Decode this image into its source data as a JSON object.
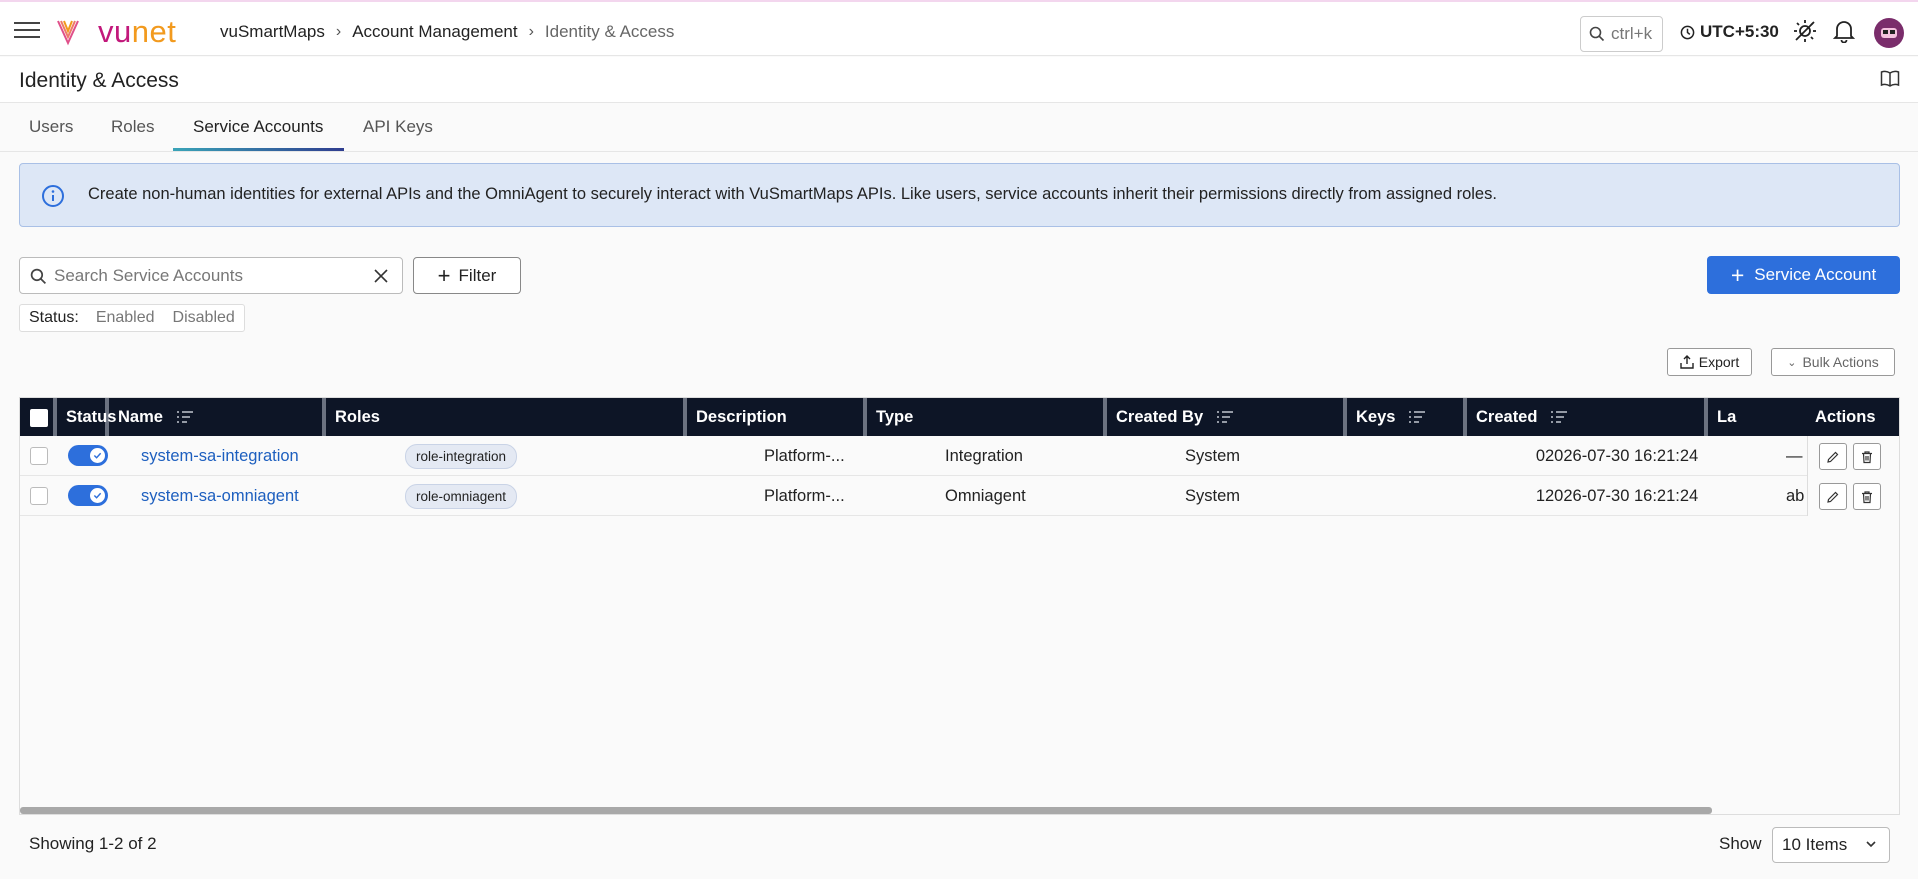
{
  "header": {
    "logo_text_a": "vu",
    "logo_text_b": "net",
    "breadcrumb": [
      "vuSmartMaps",
      "Account Management",
      "Identity & Access"
    ],
    "command_hint": "ctrl+k",
    "timezone": "UTC+5:30"
  },
  "page": {
    "title": "Identity & Access"
  },
  "tabs": [
    {
      "label": "Users",
      "active": false
    },
    {
      "label": "Roles",
      "active": false
    },
    {
      "label": "Service Accounts",
      "active": true
    },
    {
      "label": "API Keys",
      "active": false
    }
  ],
  "info_banner": {
    "text": "Create non-human identities for external APIs and the OmniAgent to securely interact with VuSmartMaps APIs. Like users, service accounts inherit their permissions directly from assigned roles."
  },
  "toolbar": {
    "search_placeholder": "Search Service Accounts",
    "filter_label": "Filter",
    "add_label": "Service Account",
    "status_label": "Status:",
    "status_options": [
      "Enabled",
      "Disabled"
    ],
    "export_label": "Export",
    "bulk_label": "Bulk Actions"
  },
  "table": {
    "columns": [
      "Status",
      "Name",
      "Roles",
      "Description",
      "Type",
      "Created By",
      "Keys",
      "Created",
      "La",
      "Actions"
    ],
    "rows": [
      {
        "enabled": true,
        "name": "system-sa-integration",
        "role": "role-integration",
        "description": "Platform-...",
        "type": "Integration",
        "created_by": "System",
        "keys": "0",
        "created": "2026-07-30 16:21:24",
        "last": "—"
      },
      {
        "enabled": true,
        "name": "system-sa-omniagent",
        "role": "role-omniagent",
        "description": "Platform-...",
        "type": "Omniagent",
        "created_by": "System",
        "keys": "1",
        "created": "2026-07-30 16:21:24",
        "last": "ab"
      }
    ]
  },
  "footer": {
    "showing": "Showing 1-2 of 2",
    "show_label": "Show",
    "page_size": "10 Items"
  },
  "colors": {
    "brand_magenta": "#c2187b",
    "brand_orange": "#f29a1e",
    "primary": "#2d6fdc",
    "table_header": "#0d1526",
    "link": "#1d5fbf"
  }
}
